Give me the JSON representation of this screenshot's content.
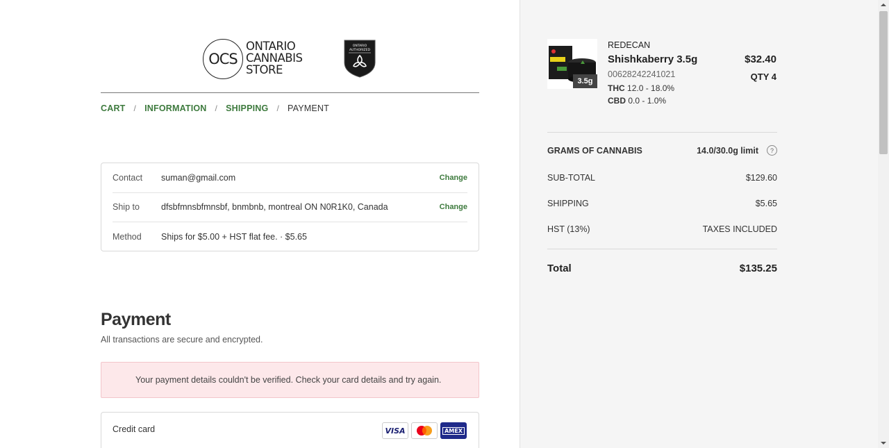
{
  "header": {
    "logo_circle_text": "OCS",
    "logo_lines": [
      "ONTARIO",
      "CANNABIS",
      "STORE"
    ],
    "badge_lines": [
      "ONTARIO",
      "AUTHORIZED"
    ]
  },
  "breadcrumb": {
    "items": [
      "CART",
      "INFORMATION",
      "SHIPPING",
      "PAYMENT"
    ],
    "separator": "/"
  },
  "review": {
    "contact_label": "Contact",
    "contact_value": "suman@gmail.com",
    "ship_label": "Ship to",
    "ship_value": "dfsbfmnsbfmnsbf, bnmbnb, montreal ON N0R1K0, Canada",
    "method_label": "Method",
    "method_value": "Ships for $5.00 + HST flat fee. · $5.65",
    "change_label": "Change"
  },
  "payment": {
    "title": "Payment",
    "subtitle": "All transactions are secure and encrypted.",
    "error": "Your payment details couldn't be verified. Check your card details and try again.",
    "method_label": "Credit card",
    "cards": [
      "VISA",
      "mastercard-icon",
      "AMEX"
    ]
  },
  "order": {
    "product": {
      "brand": "REDECAN",
      "name": "Shishkaberry 3.5g",
      "sku": "00628242241021",
      "thc_label": "THC",
      "thc_value": "12.0 - 18.0%",
      "cbd_label": "CBD",
      "cbd_value": "0.0 - 1.0%",
      "badge": "3.5g",
      "price": "$32.40",
      "qty": "QTY 4"
    },
    "summary": {
      "grams_label": "GRAMS OF CANNABIS",
      "grams_value": "14.0/30.0g limit",
      "subtotal_label": "SUB-TOTAL",
      "subtotal_value": "$129.60",
      "shipping_label": "SHIPPING",
      "shipping_value": "$5.65",
      "hst_label": "HST (13%)",
      "hst_value": "TAXES INCLUDED",
      "total_label": "Total",
      "total_value": "$135.25"
    }
  },
  "colors": {
    "accent_green": "#3d7a3d",
    "error_bg": "#fde8ea",
    "sidebar_bg": "#f5f5f5"
  }
}
